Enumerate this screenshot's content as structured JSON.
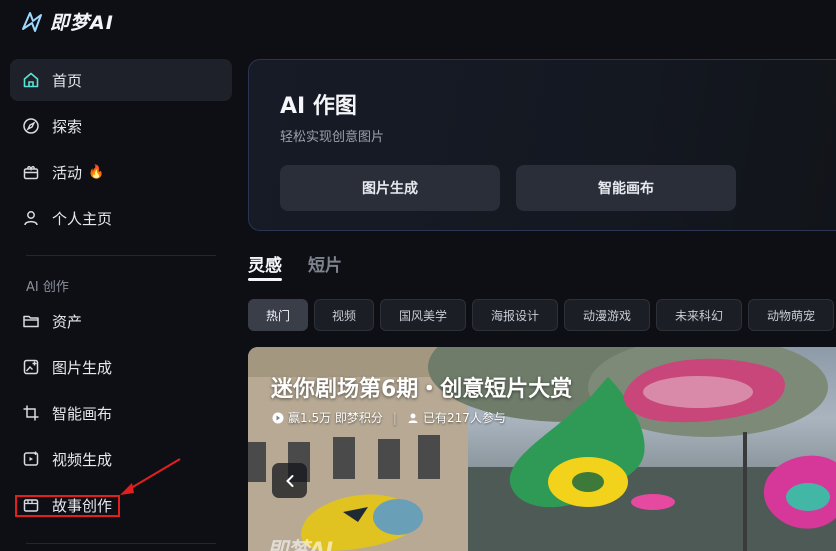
{
  "app": {
    "logo_text": "即梦AI"
  },
  "sidebar": {
    "items": [
      {
        "label": "首页",
        "icon": "home-icon"
      },
      {
        "label": "探索",
        "icon": "compass-icon"
      },
      {
        "label": "活动",
        "icon": "gift-icon",
        "badge": "🔥"
      },
      {
        "label": "个人主页",
        "icon": "user-icon"
      }
    ],
    "section_label": "AI 创作",
    "creation_items": [
      {
        "label": "资产",
        "icon": "folder-icon"
      },
      {
        "label": "图片生成",
        "icon": "image-add-icon"
      },
      {
        "label": "智能画布",
        "icon": "crop-canvas-icon"
      },
      {
        "label": "视频生成",
        "icon": "video-add-icon"
      },
      {
        "label": "故事创作",
        "icon": "story-icon"
      }
    ]
  },
  "ai_card": {
    "title": "AI 作图",
    "subtitle": "轻松实现创意图片",
    "buttons": [
      "图片生成",
      "智能画布"
    ]
  },
  "tabs": [
    {
      "label": "灵感",
      "active": true
    },
    {
      "label": "短片",
      "active": false
    }
  ],
  "chips": [
    "热门",
    "视频",
    "国风美学",
    "海报设计",
    "动漫游戏",
    "未来科幻",
    "动物萌宠"
  ],
  "banner": {
    "title": "迷你剧场第6期・创意短片大赏",
    "reward": "赢1.5万 即梦积分",
    "participants": "已有217人参与",
    "watermark": "即梦AI"
  },
  "colors": {
    "accent_border": "#2b3450",
    "highlight": "#e0201e",
    "background": "#0d0f14"
  }
}
